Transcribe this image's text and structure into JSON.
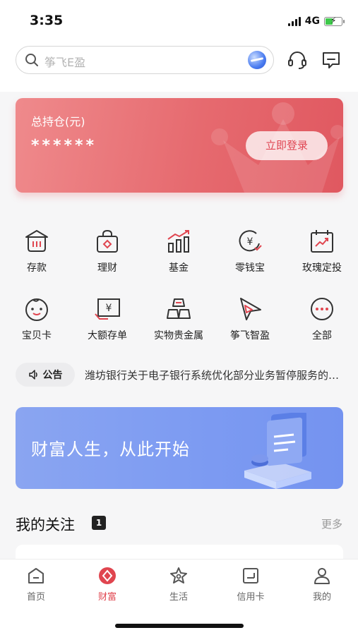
{
  "status_bar": {
    "time": "3:35",
    "network": "4G"
  },
  "search": {
    "placeholder": "筝飞E盈"
  },
  "holdings": {
    "label": "总持仓(元)",
    "masked_amount": "******",
    "login_label": "立即登录"
  },
  "quick_grid": [
    {
      "label": "存款",
      "icon": "bank-icon"
    },
    {
      "label": "理财",
      "icon": "wealth-bag-icon"
    },
    {
      "label": "基金",
      "icon": "fund-chart-icon"
    },
    {
      "label": "零钱宝",
      "icon": "change-treasure-icon"
    },
    {
      "label": "玫瑰定投",
      "icon": "calendar-invest-icon"
    },
    {
      "label": "宝贝卡",
      "icon": "baby-face-icon"
    },
    {
      "label": "大额存单",
      "icon": "large-deposit-icon"
    },
    {
      "label": "实物贵金属",
      "icon": "gold-bars-icon"
    },
    {
      "label": "筝飞智盈",
      "icon": "kite-icon"
    },
    {
      "label": "全部",
      "icon": "more-dots-icon"
    }
  ],
  "notice": {
    "tag": "公告",
    "text": "潍坊银行关于电子银行系统优化部分业务暂停服务的公告"
  },
  "banner": {
    "text": "财富人生，从此开始"
  },
  "follow": {
    "title": "我的关注",
    "badge": "1",
    "more": "更多"
  },
  "tabbar": [
    {
      "label": "首页",
      "icon": "home-icon",
      "active": false
    },
    {
      "label": "财富",
      "icon": "wealth-icon",
      "active": true
    },
    {
      "label": "生活",
      "icon": "life-icon",
      "active": false
    },
    {
      "label": "信用卡",
      "icon": "credit-card-icon",
      "active": false
    },
    {
      "label": "我的",
      "icon": "profile-icon",
      "active": false
    }
  ],
  "colors": {
    "accent": "#e0454f",
    "card_red": "#e66a6f",
    "banner_blue": "#7e9cf2",
    "icon_red": "#e0454f",
    "icon_dark": "#333333"
  }
}
